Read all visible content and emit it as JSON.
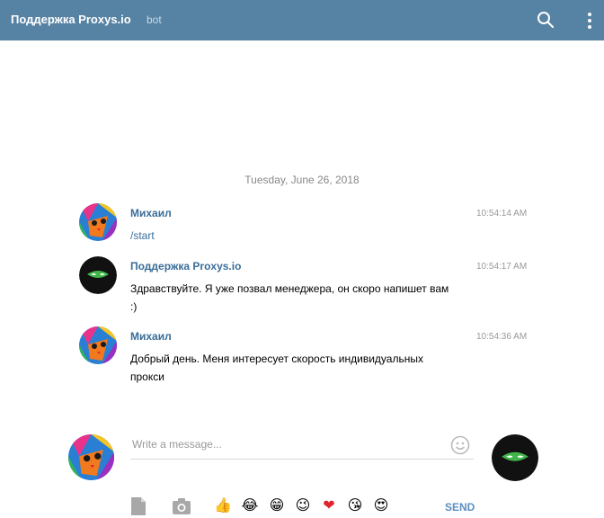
{
  "header": {
    "title": "Поддержка Proxys.io",
    "badge": "bot",
    "icons": [
      "search-icon",
      "more-vertical-icon"
    ],
    "bg_color": "#5682a3"
  },
  "chat": {
    "date": "Tuesday, June 26, 2018",
    "messages": [
      {
        "sender": "Михаил",
        "time": "10:54:14 AM",
        "text": "/start",
        "avatar": "colorful-cat-avatar"
      },
      {
        "sender": "Поддержка Proxys.io",
        "time": "10:54:17 AM",
        "text": "Здравствуйте. Я уже позвал менеджера, он скоро напишет вам :)",
        "avatar": "ninja-mask-bot-avatar"
      },
      {
        "sender": "Михаил",
        "time": "10:54:36 AM",
        "text": "Добрый день. Меня интересует скорость индивидуальных прокси ",
        "avatar": "colorful-cat-avatar"
      }
    ]
  },
  "composer": {
    "placeholder": "Write a message...",
    "send_label": "SEND",
    "emojis": [
      "👍",
      "😂",
      "😁",
      "😉",
      "❤",
      "😘",
      "😍"
    ]
  }
}
